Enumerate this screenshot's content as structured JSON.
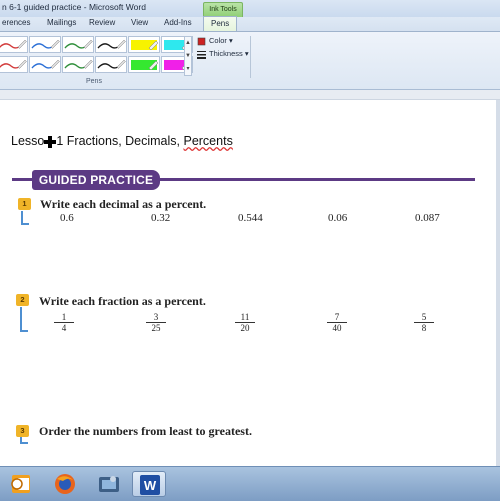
{
  "window": {
    "title": "n 6-1 guided practice - Microsoft Word",
    "contextual_tab_group": "Ink Tools"
  },
  "tabs": [
    {
      "label": "erences"
    },
    {
      "label": "Mailings"
    },
    {
      "label": "Review"
    },
    {
      "label": "View"
    },
    {
      "label": "Add-Ins"
    },
    {
      "label": "Pens",
      "active": true
    }
  ],
  "ribbon": {
    "group_label": "Pens",
    "color_label": "Color",
    "thickness_label": "Thickness",
    "pens": [
      {
        "color": "#d23a3a",
        "kind": "pen"
      },
      {
        "color": "#2b6fd6",
        "kind": "pen"
      },
      {
        "color": "#2f8f3a",
        "kind": "pen"
      },
      {
        "color": "#1a1a1a",
        "kind": "pen"
      },
      {
        "color": "#f7f300",
        "kind": "highlighter"
      },
      {
        "color": "#2ee8ee",
        "kind": "highlighter"
      },
      {
        "color": "#d23a3a",
        "kind": "pen"
      },
      {
        "color": "#2b6fd6",
        "kind": "pen"
      },
      {
        "color": "#2f8f3a",
        "kind": "pen"
      },
      {
        "color": "#1a1a1a",
        "kind": "pen"
      },
      {
        "color": "#35e830",
        "kind": "highlighter"
      },
      {
        "color": "#f020e8",
        "kind": "highlighter"
      }
    ]
  },
  "document": {
    "lesson_title_a": "Lesso",
    "lesson_title_b": "1 Fractions, Decimals, ",
    "lesson_title_c": "Percents",
    "banner": "GUIDED PRACTICE",
    "q1": {
      "number": "1",
      "text": "Write each decimal as a percent.",
      "values": [
        "0.6",
        "0.32",
        "0.544",
        "0.06",
        "0.087"
      ]
    },
    "q2": {
      "number": "2",
      "text": "Write each fraction as a percent.",
      "fractions": [
        {
          "n": "1",
          "d": "4"
        },
        {
          "n": "3",
          "d": "25"
        },
        {
          "n": "11",
          "d": "20"
        },
        {
          "n": "7",
          "d": "40"
        },
        {
          "n": "5",
          "d": "8"
        }
      ]
    },
    "q3": {
      "number": "3",
      "text": "Order the numbers from least to greatest."
    }
  },
  "taskbar": {
    "apps": [
      {
        "icon": "outlook-icon"
      },
      {
        "icon": "firefox-icon"
      },
      {
        "icon": "media-icon"
      },
      {
        "icon": "word-icon",
        "active": true
      }
    ]
  }
}
